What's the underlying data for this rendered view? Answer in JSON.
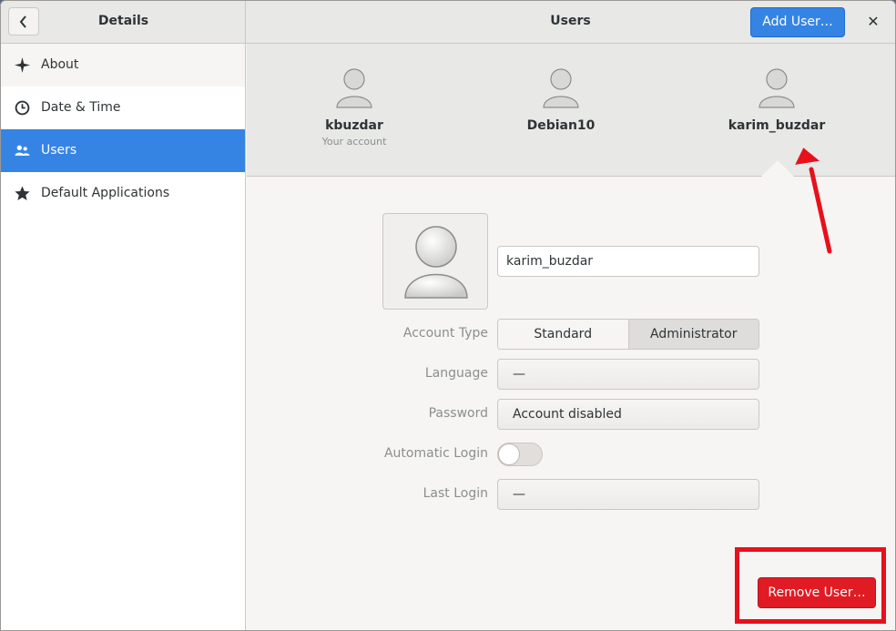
{
  "sidebar_header": {
    "title": "Details"
  },
  "main_header": {
    "title": "Users",
    "add_user_label": "Add User…"
  },
  "sidebar": {
    "items": [
      {
        "label": "About",
        "icon": "sparkle-icon"
      },
      {
        "label": "Date & Time",
        "icon": "clock-icon"
      },
      {
        "label": "Users",
        "icon": "users-icon",
        "active": true
      },
      {
        "label": "Default Applications",
        "icon": "star-icon"
      }
    ]
  },
  "users": [
    {
      "name": "kbuzdar",
      "subtitle": "Your account"
    },
    {
      "name": "Debian10",
      "subtitle": ""
    },
    {
      "name": "karim_buzdar",
      "subtitle": "",
      "selected": true
    }
  ],
  "details": {
    "username": "karim_buzdar",
    "account_type_label": "Account Type",
    "account_type_options": [
      "Standard",
      "Administrator"
    ],
    "account_type_selected": "Administrator",
    "language_label": "Language",
    "language_value": "—",
    "password_label": "Password",
    "password_value": "Account disabled",
    "auto_login_label": "Automatic Login",
    "auto_login_on": false,
    "last_login_label": "Last Login",
    "last_login_value": "—"
  },
  "remove_user_label": "Remove User…",
  "colors": {
    "accent": "#3584e4",
    "destructive": "#e01b24",
    "annotation": "#e8101b"
  }
}
